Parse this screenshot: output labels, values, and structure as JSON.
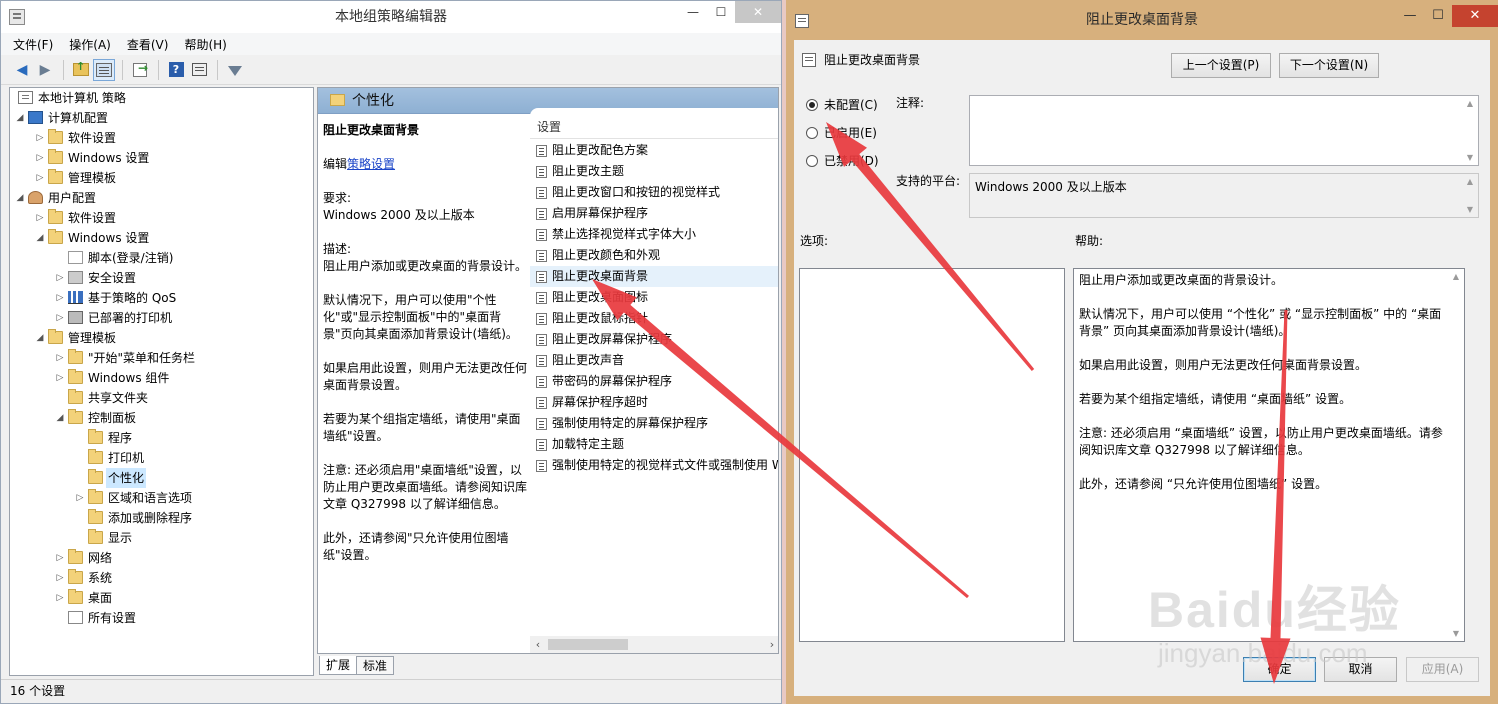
{
  "editor": {
    "title": "本地组策略编辑器",
    "menu": [
      "文件(F)",
      "操作(A)",
      "查看(V)",
      "帮助(H)"
    ],
    "tree": [
      {
        "label": "本地计算机 策略",
        "level": 0,
        "icon": "doc",
        "exp": ""
      },
      {
        "label": "计算机配置",
        "level": 1,
        "icon": "computer",
        "exp": "◢"
      },
      {
        "label": "软件设置",
        "level": 2,
        "icon": "folder",
        "exp": "▷"
      },
      {
        "label": "Windows 设置",
        "level": 2,
        "icon": "folder",
        "exp": "▷"
      },
      {
        "label": "管理模板",
        "level": 2,
        "icon": "folder",
        "exp": "▷"
      },
      {
        "label": "用户配置",
        "level": 1,
        "icon": "user",
        "exp": "◢"
      },
      {
        "label": "软件设置",
        "level": 2,
        "icon": "folder",
        "exp": "▷"
      },
      {
        "label": "Windows 设置",
        "level": 2,
        "icon": "folder",
        "exp": "◢"
      },
      {
        "label": "脚本(登录/注销)",
        "level": 3,
        "icon": "script",
        "exp": ""
      },
      {
        "label": "安全设置",
        "level": 3,
        "icon": "shield",
        "exp": "▷"
      },
      {
        "label": "基于策略的 QoS",
        "level": 3,
        "icon": "chart",
        "exp": "▷"
      },
      {
        "label": "已部署的打印机",
        "level": 3,
        "icon": "printer",
        "exp": "▷"
      },
      {
        "label": "管理模板",
        "level": 2,
        "icon": "folder",
        "exp": "◢"
      },
      {
        "label": "\"开始\"菜单和任务栏",
        "level": 3,
        "icon": "folder",
        "exp": "▷"
      },
      {
        "label": "Windows 组件",
        "level": 3,
        "icon": "folder",
        "exp": "▷"
      },
      {
        "label": "共享文件夹",
        "level": 3,
        "icon": "folder",
        "exp": ""
      },
      {
        "label": "控制面板",
        "level": 3,
        "icon": "folder",
        "exp": "◢"
      },
      {
        "label": "程序",
        "level": 4,
        "icon": "folder",
        "exp": ""
      },
      {
        "label": "打印机",
        "level": 4,
        "icon": "folder",
        "exp": ""
      },
      {
        "label": "个性化",
        "level": 4,
        "icon": "folder",
        "exp": "",
        "selected": true
      },
      {
        "label": "区域和语言选项",
        "level": 4,
        "icon": "folder",
        "exp": "▷"
      },
      {
        "label": "添加或删除程序",
        "level": 4,
        "icon": "folder",
        "exp": ""
      },
      {
        "label": "显示",
        "level": 4,
        "icon": "folder",
        "exp": ""
      },
      {
        "label": "网络",
        "level": 3,
        "icon": "folder",
        "exp": "▷"
      },
      {
        "label": "系统",
        "level": 3,
        "icon": "folder",
        "exp": "▷"
      },
      {
        "label": "桌面",
        "level": 3,
        "icon": "folder",
        "exp": "▷"
      },
      {
        "label": "所有设置",
        "level": 3,
        "icon": "allset",
        "exp": ""
      }
    ],
    "header_title": "个性化",
    "desc": {
      "title": "阻止更改桌面背景",
      "edit_prefix": "编辑",
      "edit_link": "策略设置",
      "req_label": "要求:",
      "req_value": "Windows 2000 及以上版本",
      "desc_label": "描述:",
      "desc_text": "阻止用户添加或更改桌面的背景设计。",
      "p1": "默认情况下，用户可以使用\"个性化\"或\"显示控制面板\"中的\"桌面背景\"页向其桌面添加背景设计(墙纸)。",
      "p2": "如果启用此设置，则用户无法更改任何桌面背景设置。",
      "p3": "若要为某个组指定墙纸，请使用\"桌面墙纸\"设置。",
      "p4": "注意: 还必须启用\"桌面墙纸\"设置，以防止用户更改桌面墙纸。请参阅知识库文章 Q327998 以了解详细信息。",
      "p5": "此外，还请参阅\"只允许使用位图墙纸\"设置。"
    },
    "list_header": "设置",
    "settings": [
      "阻止更改配色方案",
      "阻止更改主题",
      "阻止更改窗口和按钮的视觉样式",
      "启用屏幕保护程序",
      "禁止选择视觉样式字体大小",
      "阻止更改颜色和外观",
      "阻止更改桌面背景",
      "阻止更改桌面图标",
      "阻止更改鼠标指针",
      "阻止更改屏幕保护程序",
      "阻止更改声音",
      "带密码的屏幕保护程序",
      "屏幕保护程序超时",
      "强制使用特定的屏幕保护程序",
      "加载特定主题",
      "强制使用特定的视觉样式文件或强制使用 Windows 经典"
    ],
    "selected_setting_index": 6,
    "tabs": [
      "扩展",
      "标准"
    ],
    "status": "16 个设置"
  },
  "dialog": {
    "title": "阻止更改桌面背景",
    "setting_name": "阻止更改桌面背景",
    "prev_btn": "上一个设置(P)",
    "next_btn": "下一个设置(N)",
    "radios": [
      {
        "label": "未配置(C)",
        "checked": true
      },
      {
        "label": "已启用(E)",
        "checked": false
      },
      {
        "label": "已禁用(D)",
        "checked": false
      }
    ],
    "comment_label": "注释:",
    "platform_label": "支持的平台:",
    "platform_value": "Windows 2000 及以上版本",
    "options_label": "选项:",
    "help_label": "帮助:",
    "help": {
      "p0": "阻止用户添加或更改桌面的背景设计。",
      "p1": "默认情况下，用户可以使用 “个性化” 或 “显示控制面板” 中的 “桌面背景” 页向其桌面添加背景设计(墙纸)。",
      "p2": "如果启用此设置，则用户无法更改任何桌面背景设置。",
      "p3": "若要为某个组指定墙纸，请使用 “桌面墙纸” 设置。",
      "p4": "注意: 还必须启用 “桌面墙纸” 设置，以防止用户更改桌面墙纸。请参阅知识库文章 Q327998 以了解详细信息。",
      "p5": "此外，还请参阅 “只允许使用位图墙纸” 设置。"
    },
    "ok_btn": "确定",
    "cancel_btn": "取消",
    "apply_btn": "应用(A)"
  },
  "watermark": {
    "logo": "Baidu经验",
    "url": "jingyan.baidu.com"
  },
  "colors": {
    "annotation_arrow": "#e8383d",
    "header_blue": "#99b8da",
    "dialog_frame": "#d7b07d"
  }
}
